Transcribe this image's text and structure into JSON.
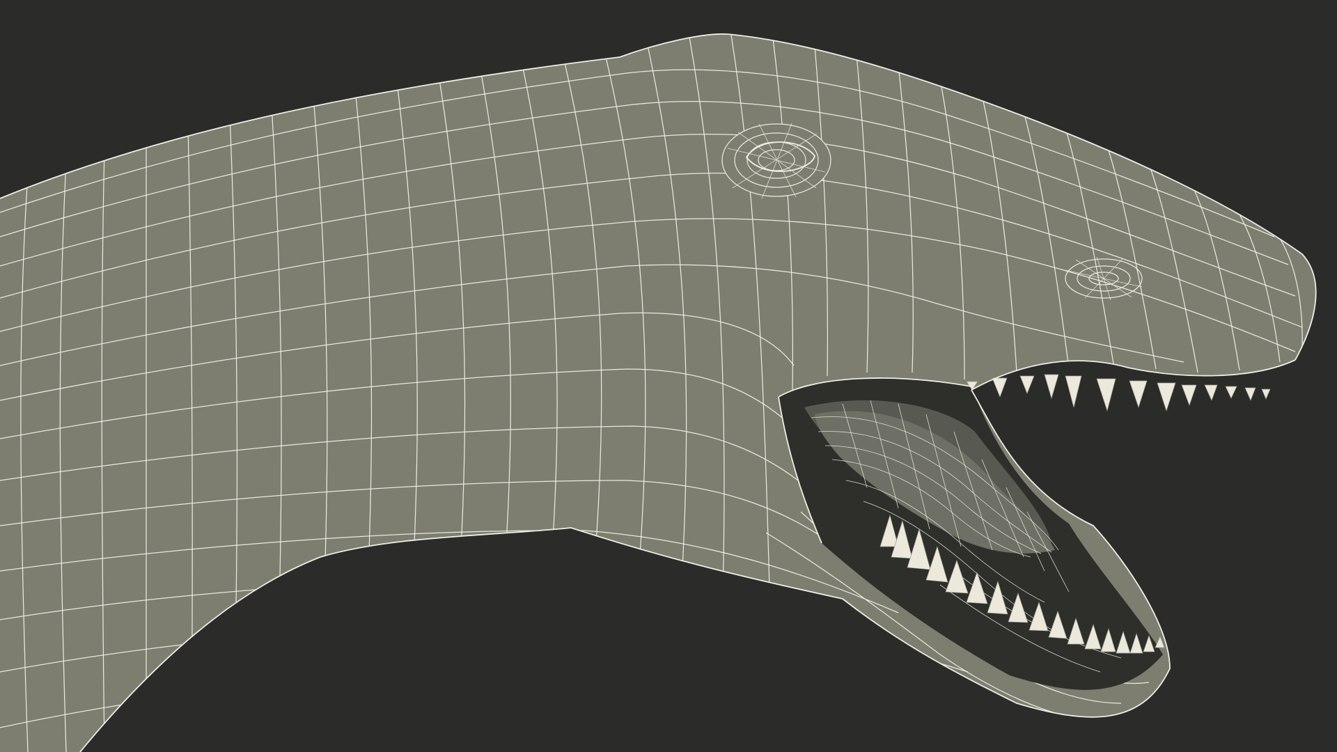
{
  "scene": {
    "subject": "wireframe-dinosaur-head",
    "background_color": "#2b2b2a",
    "skin_color": "#7d7e70",
    "wire_color": "#f0eee6",
    "mouth_color": "#2e2f2b",
    "tooth_color": "#ece9dc"
  }
}
